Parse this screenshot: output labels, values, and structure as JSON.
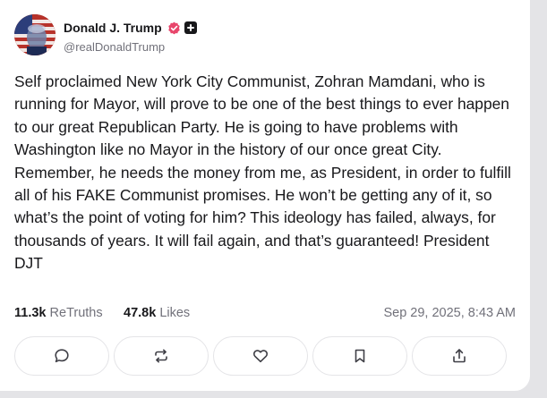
{
  "post": {
    "author": {
      "display_name": "Donald J. Trump",
      "handle": "@realDonaldTrump",
      "verified_badge_color": "#e11d48"
    },
    "text": "Self proclaimed New York City Communist, Zohran Mamdani, who is running for Mayor, will prove to be one of the best things to ever happen to our great Republican Party. He is going to have problems with Washington like no Mayor in the history of our once great City. Remember, he needs the money from me, as President, in order to fulfill all of his FAKE Communist promises. He won’t be getting any of it, so what’s the point of voting for him? This ideology has failed, always, for thousands of years. It will fail again, and that’s guaranteed!  President DJT",
    "stats": {
      "retruths_count": "11.3k",
      "retruths_label": "ReTruths",
      "likes_count": "47.8k",
      "likes_label": "Likes"
    },
    "timestamp": "Sep 29, 2025, 8:43 AM"
  },
  "actions": [
    {
      "name": "reply",
      "icon": "chat-bubble-icon"
    },
    {
      "name": "retruth",
      "icon": "repost-icon"
    },
    {
      "name": "like",
      "icon": "heart-icon"
    },
    {
      "name": "bookmark",
      "icon": "bookmark-icon"
    },
    {
      "name": "share",
      "icon": "share-icon"
    }
  ],
  "colors": {
    "text_primary": "#18181b",
    "text_secondary": "#71717a",
    "border": "#e4e4e7"
  }
}
